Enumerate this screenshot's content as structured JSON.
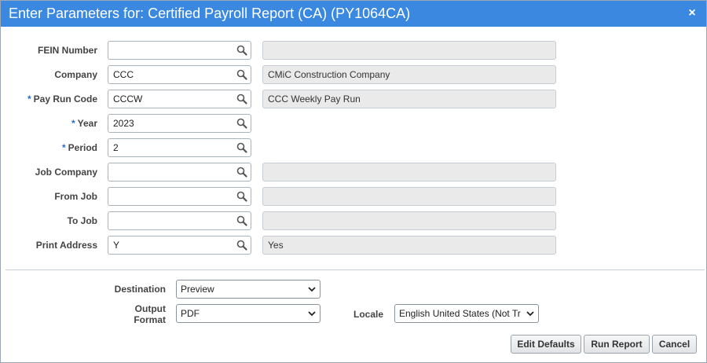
{
  "dialog": {
    "title": "Enter Parameters for: Certified Payroll Report (CA) (PY1064CA)",
    "close_glyph": "×"
  },
  "params": [
    {
      "label": "FEIN Number",
      "required": false,
      "value": "",
      "description": "",
      "has_description": true
    },
    {
      "label": "Company",
      "required": false,
      "value": "CCC",
      "description": "CMiC Construction Company",
      "has_description": true
    },
    {
      "label": "Pay Run Code",
      "required": true,
      "value": "CCCW",
      "description": "CCC Weekly Pay Run",
      "has_description": true
    },
    {
      "label": "Year",
      "required": true,
      "value": "2023",
      "description": "",
      "has_description": false
    },
    {
      "label": "Period",
      "required": true,
      "value": "2",
      "description": "",
      "has_description": false
    },
    {
      "label": "Job Company",
      "required": false,
      "value": "",
      "description": "",
      "has_description": true
    },
    {
      "label": "From Job",
      "required": false,
      "value": "",
      "description": "",
      "has_description": true
    },
    {
      "label": "To Job",
      "required": false,
      "value": "",
      "description": "",
      "has_description": true
    },
    {
      "label": "Print Address",
      "required": false,
      "value": "Y",
      "description": "Yes",
      "has_description": true
    }
  ],
  "required_marker": "*",
  "output": {
    "destination_label": "Destination",
    "destination_value": "Preview",
    "format_label_line1": "Output",
    "format_label_line2": "Format",
    "format_value": "PDF",
    "locale_label": "Locale",
    "locale_value": "English United States (Not Tr"
  },
  "buttons": {
    "edit_defaults": "Edit Defaults",
    "run_report": "Run Report",
    "cancel": "Cancel"
  },
  "icons": {
    "lov": "search-icon",
    "caret": "chevron-down-icon",
    "close": "close-icon"
  },
  "colors": {
    "titlebar": "#3b88e0",
    "required": "#2a6ccf"
  }
}
